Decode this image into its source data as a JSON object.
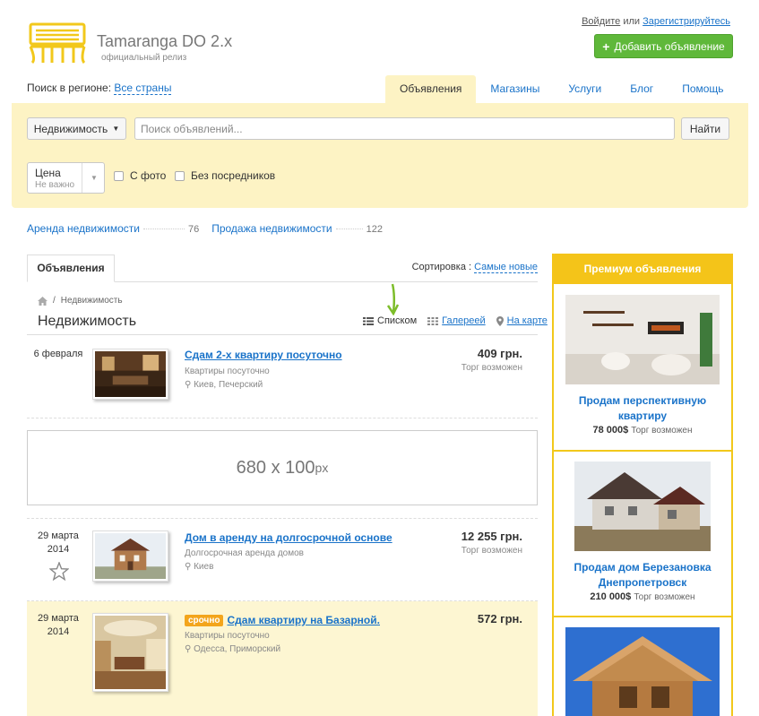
{
  "header": {
    "site_title": "Tamaranga DO 2.x",
    "site_subtitle": "официальный релиз",
    "login": "Войдите",
    "or": "или",
    "register": "Зарегистрируйтесь",
    "add_button": "Добавить объявление",
    "region_label": "Поиск в регионе:",
    "region_value": "Все страны"
  },
  "nav": {
    "items": [
      {
        "label": "Объявления"
      },
      {
        "label": "Магазины"
      },
      {
        "label": "Услуги"
      },
      {
        "label": "Блог"
      },
      {
        "label": "Помощь"
      }
    ]
  },
  "search": {
    "category": "Недвижимость",
    "placeholder": "Поиск объявлений...",
    "find_button": "Найти",
    "price_label": "Цена",
    "price_value": "Не важно",
    "with_photo": "С фото",
    "no_agents": "Без посредников"
  },
  "categories": [
    {
      "label": "Аренда недвижимости",
      "count": "76"
    },
    {
      "label": "Продажа недвижимости",
      "count": "122"
    }
  ],
  "listing": {
    "tab": "Объявления",
    "sort_label": "Сортировка :",
    "sort_value": "Самые новые",
    "crumb": "Недвижимость",
    "title": "Недвижимость",
    "view_list": "Списком",
    "view_gallery": "Галерeей",
    "view_map": "На карте",
    "banner_main": "680 x 100",
    "banner_unit": "px"
  },
  "items": [
    {
      "date1": "6 февраля",
      "date2": "",
      "title": "Сдам 2-х квартиру посуточно",
      "category": "Квартиры посуточно",
      "location": "Киев, Печерский",
      "price": "409 грн.",
      "haggle": "Торг возможен"
    },
    {
      "date1": "29 марта",
      "date2": "2014",
      "title": "Дом в аренду на долгосрочной основе",
      "category": "Долгосрочная аренда домов",
      "location": "Киев",
      "price": "12 255 грн.",
      "haggle": "Торг возможен"
    },
    {
      "date1": "29 марта",
      "date2": "2014",
      "urgent": "срочно",
      "title": "Сдам квартиру на Базарной.",
      "category": "Квартиры посуточно",
      "location": "Одесса, Приморский",
      "price": "572 грн.",
      "haggle": ""
    }
  ],
  "premium": {
    "heading": "Премиум объявления",
    "items": [
      {
        "title": "Продам перспективную квартиру",
        "price": "78 000$",
        "note": "Торг возможен"
      },
      {
        "title": "Продам дом Березановка Днепропетровск",
        "price": "210 000$",
        "note": "Торг возможен"
      }
    ]
  },
  "colors": {
    "accent_green": "#5fb83a",
    "panel_yellow": "#fdf3c4",
    "premium_yellow": "#f4c419",
    "link_blue": "#1a73c9",
    "urgent_orange": "#f3a51c"
  }
}
